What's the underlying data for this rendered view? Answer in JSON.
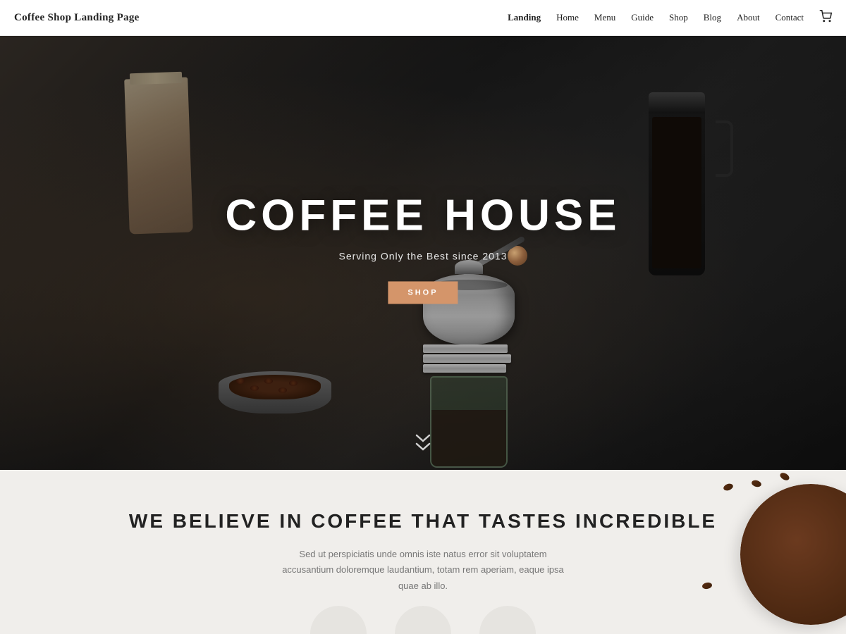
{
  "header": {
    "title": "Coffee Shop Landing Page",
    "nav": {
      "items": [
        {
          "label": "Landing",
          "active": true
        },
        {
          "label": "Home",
          "active": false
        },
        {
          "label": "Menu",
          "active": false
        },
        {
          "label": "Guide",
          "active": false
        },
        {
          "label": "Shop",
          "active": false
        },
        {
          "label": "Blog",
          "active": false
        },
        {
          "label": "About",
          "active": false
        },
        {
          "label": "Contact",
          "active": false
        }
      ],
      "cart_icon": "🛒"
    }
  },
  "hero": {
    "title": "COFFEE HOUSE",
    "subtitle": "Serving Only the Best since 2013",
    "shop_button": "SHOP",
    "scroll_icon": "❯❯"
  },
  "about": {
    "title": "WE BELIEVE IN COFFEE THAT TASTES INCREDIBLE",
    "body": "Sed ut perspiciatis unde omnis iste natus error sit voluptatem accusantium doloremque laudantium, totam rem aperiam, eaque ipsa quae ab illo."
  },
  "colors": {
    "hero_btn": "#d4956a",
    "nav_active": "#222",
    "about_bg": "#f0eeeb",
    "title_color": "#222",
    "text_color": "#777"
  }
}
